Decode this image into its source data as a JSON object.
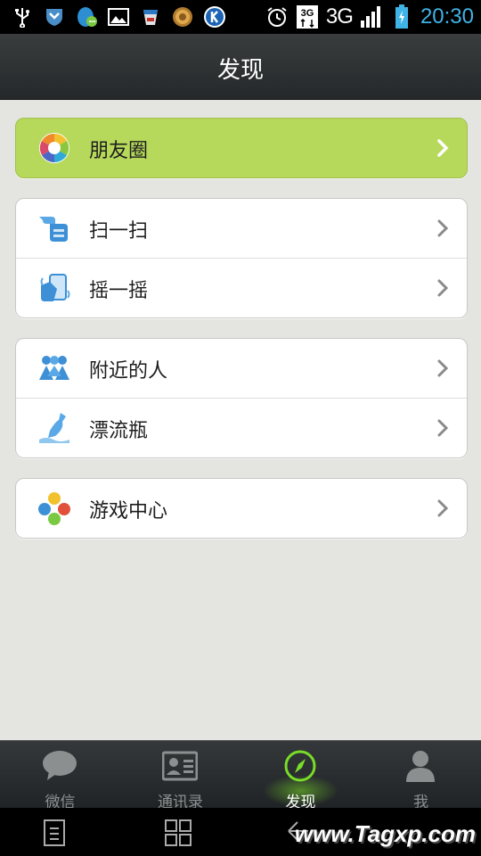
{
  "status_bar": {
    "network": "3G",
    "time": "20:30",
    "icons": [
      "usb-icon",
      "shield-icon",
      "qq-icon",
      "image-icon",
      "cup-icon",
      "coin-icon",
      "k-icon",
      "alarm-icon",
      "3g-data-icon",
      "signal-icon",
      "battery-icon"
    ]
  },
  "header": {
    "title": "发现"
  },
  "groups": [
    {
      "items": [
        {
          "label": "朋友圈",
          "icon": "moments-icon"
        }
      ]
    },
    {
      "items": [
        {
          "label": "扫一扫",
          "icon": "scan-icon"
        },
        {
          "label": "摇一摇",
          "icon": "shake-icon"
        }
      ]
    },
    {
      "items": [
        {
          "label": "附近的人",
          "icon": "people-nearby-icon"
        },
        {
          "label": "漂流瓶",
          "icon": "drift-bottle-icon"
        }
      ]
    },
    {
      "items": [
        {
          "label": "游戏中心",
          "icon": "game-center-icon"
        }
      ]
    }
  ],
  "tabs": [
    {
      "label": "微信",
      "icon": "chat-icon"
    },
    {
      "label": "通讯录",
      "icon": "contacts-icon"
    },
    {
      "label": "发现",
      "icon": "compass-icon",
      "active": true
    },
    {
      "label": "我",
      "icon": "profile-icon"
    }
  ],
  "nav": [
    "menu-icon",
    "home-icon",
    "back-icon"
  ],
  "watermark": "www.Tagxp.com",
  "colors": {
    "accent_green": "#b6d95c",
    "time_blue": "#3fb3e6",
    "tab_active_green": "#78dc28"
  }
}
